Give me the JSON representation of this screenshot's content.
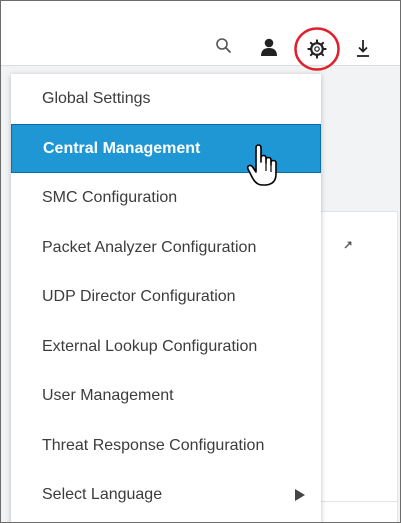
{
  "header": {
    "icons": [
      "search-icon",
      "user-icon",
      "gear-icon",
      "download-icon"
    ]
  },
  "menu": {
    "items": [
      {
        "label": "Global Settings"
      },
      {
        "label": "Central Management",
        "active": true
      },
      {
        "label": "SMC Configuration"
      },
      {
        "label": "Packet Analyzer Configuration"
      },
      {
        "label": "UDP Director Configuration"
      },
      {
        "label": "External Lookup Configuration"
      },
      {
        "label": "User Management"
      },
      {
        "label": "Threat Response Configuration"
      },
      {
        "label": "Select Language",
        "has_submenu": true
      }
    ]
  },
  "colors": {
    "active_background": "#1e97d4",
    "highlight_ring": "#e0202a"
  }
}
